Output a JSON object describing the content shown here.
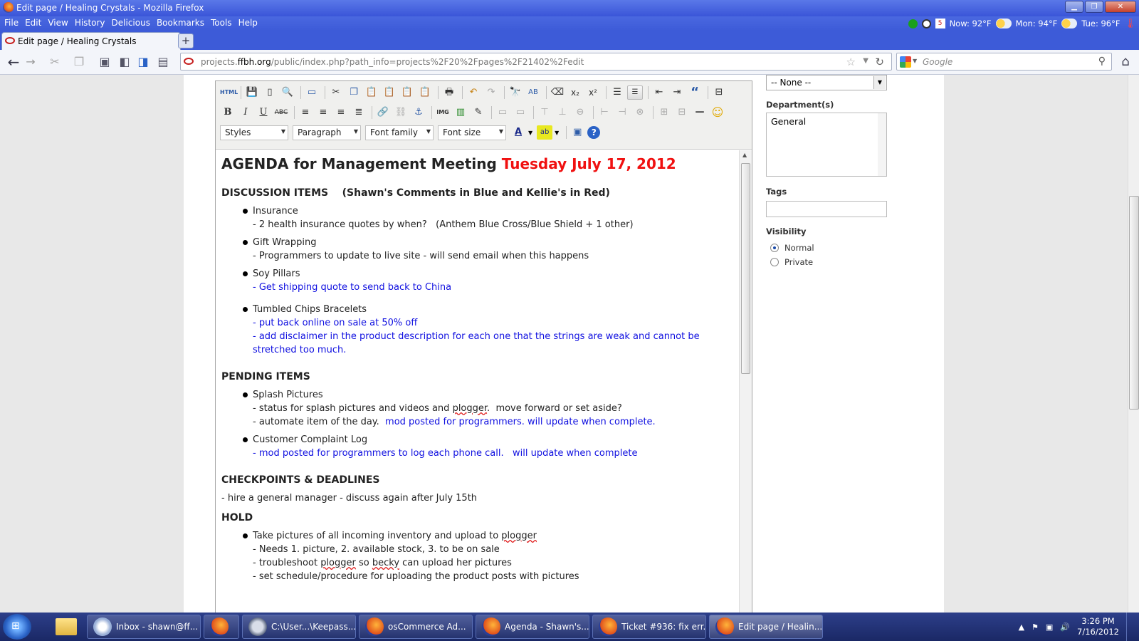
{
  "window": {
    "title": "Edit page / Healing Crystals - Mozilla Firefox"
  },
  "menu": [
    "File",
    "Edit",
    "View",
    "History",
    "Delicious",
    "Bookmarks",
    "Tools",
    "Help"
  ],
  "weather": {
    "now": "Now: 92°F",
    "mon": "Mon: 94°F",
    "tue": "Tue: 96°F",
    "calendar_day": "5"
  },
  "tab": {
    "label": "Edit page / Healing Crystals",
    "new_tab": "+"
  },
  "address": {
    "prefix": "projects.",
    "domain": "ffbh.org",
    "path": "/public/index.php?path_info=projects%2F20%2Fpages%2F21402%2Fedit"
  },
  "search": {
    "placeholder": "Google"
  },
  "editor": {
    "toolbar_row1": [
      "HTML"
    ],
    "selects": {
      "styles": "Styles",
      "format": "Paragraph",
      "font_family": "Font family",
      "font_size": "Font size"
    },
    "title_black": "AGENDA for Management Meeting",
    "title_red": "Tuesday July 17, 2012",
    "sections": {
      "discussion": "DISCUSSION ITEMS    (Shawn's Comments in Blue and Kellie's in Red)",
      "pending": "PENDING ITEMS",
      "checkpoints": "CHECKPOINTS & DEADLINES",
      "hold": "HOLD"
    },
    "discussion_items": {
      "insurance": "Insurance",
      "insurance_sub": "- 2 health insurance quotes by when?   (Anthem Blue Cross/Blue Shield + 1 other)",
      "gift": "Gift Wrapping",
      "gift_sub": "- Programmers to update to live site - will send email when this happens",
      "soy": "Soy Pillars",
      "soy_sub": "- Get shipping quote to send back to China",
      "tumbled": "Tumbled Chips Bracelets",
      "tumbled_sub1": "- put back online on sale at 50% off",
      "tumbled_sub2": "- add disclaimer in the product description for each one that the strings are weak and cannot be stretched too much."
    },
    "pending_items": {
      "splash": "Splash Pictures",
      "splash_sub1_a": "- status for splash pictures and videos and ",
      "splash_sub1_b": "plogger",
      "splash_sub1_c": ".  move forward or set aside?",
      "splash_sub2_black": "- automate item of the day.",
      "splash_sub2_blue": "mod posted for programmers.  will update when complete.",
      "complaint": "Customer Complaint Log",
      "complaint_sub": "- mod posted for programmers to log each phone call.   will update when complete"
    },
    "checkpoint_text": "- hire a general manager - discuss again after July 15th",
    "hold_items": {
      "pictures_a": "Take pictures of all incoming inventory and upload to ",
      "pictures_b": "plogger",
      "needs": "- Needs 1. picture, 2. available stock, 3. to be on sale",
      "troubleshoot_a": "- troubleshoot ",
      "troubleshoot_b": "plogger",
      "troubleshoot_c": " so ",
      "troubleshoot_d": "becky",
      "troubleshoot_e": " can upload her pictures",
      "schedule": "- set schedule/procedure for uploading the product posts with pictures"
    }
  },
  "sidebar": {
    "select_value": "-- None --",
    "departments_label": "Department(s)",
    "departments": [
      "General"
    ],
    "tags_label": "Tags",
    "tags_value": "",
    "visibility_label": "Visibility",
    "visibility_options": [
      "Normal",
      "Private"
    ],
    "visibility_selected": "Normal"
  },
  "taskbar": {
    "apps": [
      "Inbox - shawn@ff...",
      "",
      "C:\\User...\\Keepass...",
      "osCommerce Ad...",
      "Agenda - Shawn's...",
      "Ticket #936: fix err...",
      "Edit page / Healin..."
    ],
    "time": "3:26 PM",
    "date": "7/16/2012"
  }
}
